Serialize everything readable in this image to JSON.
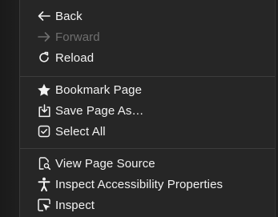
{
  "context_menu": {
    "navigation": {
      "back": {
        "label": "Back",
        "icon": "arrow-left-icon",
        "enabled": true
      },
      "forward": {
        "label": "Forward",
        "icon": "arrow-right-icon",
        "enabled": false
      },
      "reload": {
        "label": "Reload",
        "icon": "reload-icon",
        "enabled": true
      }
    },
    "page": {
      "bookmark": {
        "label": "Bookmark Page",
        "icon": "star-icon"
      },
      "save_as": {
        "label": "Save Page As…",
        "icon": "save-icon"
      },
      "select_all": {
        "label": "Select All",
        "icon": "select-all-icon"
      }
    },
    "developer": {
      "view_source": {
        "label": "View Page Source",
        "icon": "page-source-icon"
      },
      "inspect_accessibility": {
        "label": "Inspect Accessibility Properties",
        "icon": "accessibility-icon"
      },
      "inspect": {
        "label": "Inspect",
        "icon": "inspect-icon"
      }
    }
  },
  "colors": {
    "menu_background": "#262626",
    "text": "#f2f2f2",
    "disabled_text": "#6f6f6f",
    "separator": "#3c3c3c"
  }
}
